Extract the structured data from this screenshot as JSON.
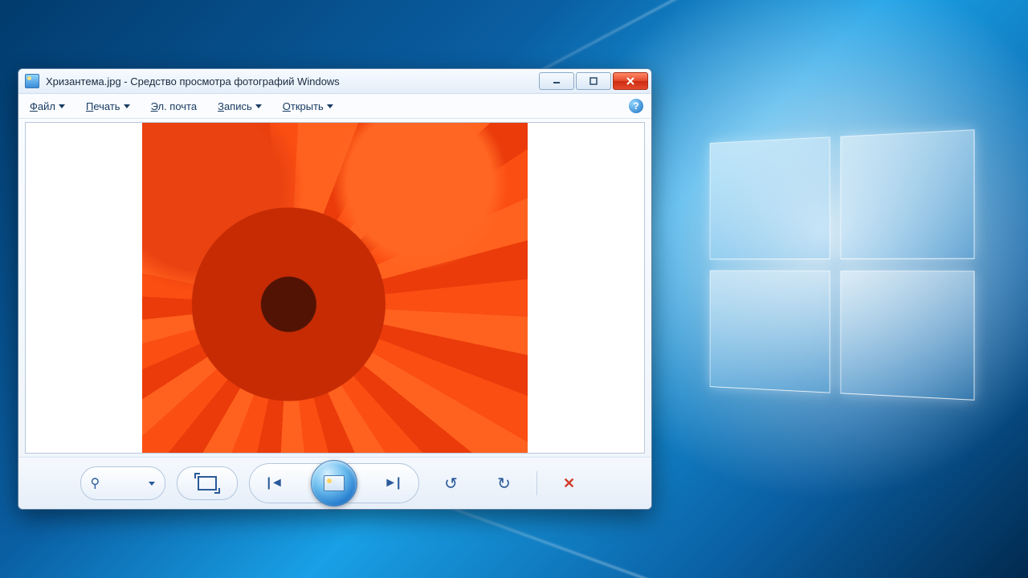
{
  "window": {
    "title": "Хризантема.jpg - Средство просмотра фотографий Windows"
  },
  "menu": {
    "file": "Файл",
    "print": "Печать",
    "email": "Эл. почта",
    "burn": "Запись",
    "open": "Открыть",
    "help_symbol": "?"
  },
  "controls": {
    "zoom_icon": "⚲",
    "fit_icon": "fit-screen-icon",
    "prev_icon": "◄",
    "next_icon": "►",
    "slideshow_icon": "slideshow-icon",
    "rotate_ccw_icon": "↺",
    "rotate_cw_icon": "↻",
    "delete_icon": "✕"
  },
  "image": {
    "subject": "chrysanthemum-flower",
    "dominant_color": "#e0491f"
  }
}
